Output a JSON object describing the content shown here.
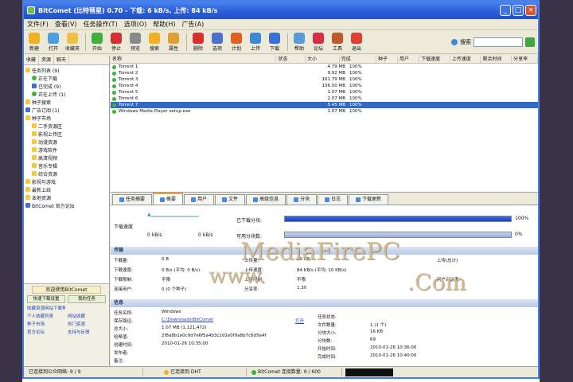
{
  "window": {
    "title": "BitComet (比特彗星) 0.70 - 下载: 6 kB/s, 上传: 84 kB/s"
  },
  "menu": [
    "文件(F)",
    "查看(V)",
    "任务操作(T)",
    "选项(O)",
    "帮助(H)",
    "广告(A)"
  ],
  "toolbar": {
    "buttons": [
      {
        "label": "新建",
        "icon": "new-icon",
        "color": "#f0b020"
      },
      {
        "label": "打开",
        "icon": "open-icon",
        "color": "#4aa0e0"
      },
      {
        "label": "收藏夹",
        "icon": "favorites-icon",
        "color": "#f0c040"
      },
      {
        "label": "开始",
        "icon": "start-icon",
        "color": "#3bb33b"
      },
      {
        "label": "停止",
        "icon": "stop-icon",
        "color": "#d83030"
      },
      {
        "label": "预览",
        "icon": "preview-icon",
        "color": "#8a8a8a"
      },
      {
        "label": "搜索",
        "icon": "search-tool-icon",
        "color": "#f0b020"
      },
      {
        "label": "属性",
        "icon": "properties-icon",
        "color": "#e0a030"
      },
      {
        "label": "删除",
        "icon": "delete-icon",
        "color": "#d83030"
      },
      {
        "label": "选项",
        "icon": "options-icon",
        "color": "#4a70d0"
      },
      {
        "label": "计划",
        "icon": "schedule-icon",
        "color": "#e06020"
      },
      {
        "label": "上传",
        "icon": "upload-icon",
        "color": "#3a8ad8"
      },
      {
        "label": "下载",
        "icon": "download-icon",
        "color": "#3a6fd8"
      },
      {
        "label": "帮助",
        "icon": "help-icon",
        "color": "#5a9ae0"
      },
      {
        "label": "论坛",
        "icon": "forum-icon",
        "color": "#d83040"
      },
      {
        "label": "工具",
        "icon": "tools-icon",
        "color": "#c05a2a"
      },
      {
        "label": "退出",
        "icon": "exit-icon",
        "color": "#e04030"
      }
    ],
    "search_label": "搜索"
  },
  "sidebar": {
    "tabs": [
      "收藏",
      "资源",
      "聊天"
    ],
    "tree": [
      {
        "label": "任务列表 (9)",
        "icon": "folder",
        "indent": 0
      },
      {
        "label": "正在下载",
        "icon": "green",
        "indent": 1
      },
      {
        "label": "已完成 (9)",
        "icon": "blue",
        "indent": 1
      },
      {
        "label": "正在上传 (1)",
        "icon": "green",
        "indent": 1
      },
      {
        "label": "种子搜索",
        "icon": "folder",
        "indent": 0
      },
      {
        "label": "广告订阅 (1)",
        "icon": "blue",
        "indent": 0
      },
      {
        "label": "种子市场",
        "icon": "folder",
        "indent": 0
      },
      {
        "label": "二手资源区",
        "icon": "folder",
        "indent": 1
      },
      {
        "label": "影视上传区",
        "icon": "folder",
        "indent": 1
      },
      {
        "label": "动漫资源",
        "icon": "folder",
        "indent": 1
      },
      {
        "label": "游戏软件",
        "icon": "folder",
        "indent": 1
      },
      {
        "label": "高清视频",
        "icon": "folder",
        "indent": 1
      },
      {
        "label": "音乐专辑",
        "icon": "folder",
        "indent": 1
      },
      {
        "label": "综合资源",
        "icon": "folder",
        "indent": 1
      },
      {
        "label": "影视与游戏",
        "icon": "folder",
        "indent": 0
      },
      {
        "label": "最新上线",
        "icon": "folder",
        "indent": 0
      },
      {
        "label": "本地资源",
        "icon": "folder",
        "indent": 0
      },
      {
        "label": "BitComet 官方论坛",
        "icon": "blue",
        "indent": 0
      }
    ],
    "bottom": {
      "header": "欢迎使用BitComet",
      "btn_left": "快速下载设置",
      "btn_right": "我的任务",
      "links": [
        [
          "收藏资源网站下载种子资源",
          ""
        ],
        [
          "个人收藏列表",
          "网站收藏"
        ],
        [
          "种子市场",
          "热门资源"
        ],
        [
          "官方论坛",
          "支持与反馈"
        ]
      ]
    }
  },
  "list": {
    "headers": [
      "名称",
      "状态",
      "大小",
      "完成",
      "种子",
      "用户",
      "下载速度",
      "上传速度",
      "剩余时间",
      "分享率"
    ],
    "rows": [
      {
        "name": "Torrent 1",
        "size": "4.79 MB",
        "done": "100%",
        "selected": false
      },
      {
        "name": "Torrent 2",
        "size": "9.92 MB",
        "done": "100%",
        "selected": false
      },
      {
        "name": "Torrent 3",
        "size": "161.79 MB",
        "done": "100%",
        "selected": false
      },
      {
        "name": "Torrent 4",
        "size": "136.00 MB",
        "done": "100%",
        "selected": false
      },
      {
        "name": "Torrent 5",
        "size": "1.07 MB",
        "done": "100%",
        "selected": false
      },
      {
        "name": "Torrent 6",
        "size": "2.07 MB",
        "done": "100%",
        "selected": false
      },
      {
        "name": "Torrent 7",
        "size": "5.45 MB",
        "done": "100%",
        "selected": true
      },
      {
        "name": "Windows Media Player setup.exe",
        "size": "1.07 MB",
        "done": "100%",
        "selected": false
      }
    ]
  },
  "tabs": [
    "任务摘要",
    "概要",
    "用户",
    "文件",
    "高级信息",
    "分块",
    "日志",
    "下载更新"
  ],
  "details": {
    "speed_label": "下载速度",
    "left_small_a": "0 kB/s",
    "left_small_b": "0 kB/s",
    "done_label": "已下载分块:",
    "avail_label": "可用分块数:",
    "done_pct_text": "100%",
    "avail_pct_text": "0%",
    "done_progress": 1.0,
    "avail_progress": 0.0,
    "section1": "传输",
    "section2": "信息",
    "transfer": [
      [
        "下载量:",
        "0 B"
      ],
      [
        "下载速度:",
        "0 B/s (平均: 0 B/s)"
      ],
      [
        "下载限制:",
        "不限"
      ],
      [
        "连接用户:",
        "0 (0 个种子)"
      ],
      [
        "上传量:",
        "80 KB"
      ],
      [
        "上传速度:",
        "84 KB/s (平均: 10 KB/s)"
      ],
      [
        "上传限制:",
        "不限"
      ],
      [
        "分享率:",
        "1.30"
      ]
    ],
    "transfer_right": [
      "上传(总计)",
      "用户对比率"
    ],
    "info": [
      [
        "任务名称:",
        "Windows"
      ],
      [
        "保存路径:",
        "C:\\Downloads\\BitComet"
      ],
      [
        "总大小:",
        "1.07 MB (1,121,472)"
      ],
      [
        "哈希值:",
        "2f8a8b1e0c9d7e6f5a4b3c2d1e0f9a8b7c6d5e4f"
      ],
      [
        "创建时间:",
        "2010-01-26 10:35:00"
      ],
      [
        "发布者:",
        ""
      ],
      [
        "备注:",
        ""
      ]
    ],
    "info_right": [
      [
        "任务状态:",
        ""
      ],
      [
        "文件数量:",
        "1 (1 个)"
      ],
      [
        "分块大小:",
        "16 KB"
      ],
      [
        "分块数:",
        "69"
      ],
      [
        "开始时间:",
        "2010-01-26 10:36:00"
      ],
      [
        "完成时间:",
        "2010-01-26 10:40:00"
      ]
    ],
    "open_link": "打开"
  },
  "status": {
    "left": "已连接到公众网络: 9 / 9",
    "mid": "已连接到 DHT",
    "right": "BitComet 连接数量: 9 / 600"
  },
  "watermark": {
    "line1": "MediaFirePC",
    "line2": "www.",
    "line3": ".Com"
  }
}
